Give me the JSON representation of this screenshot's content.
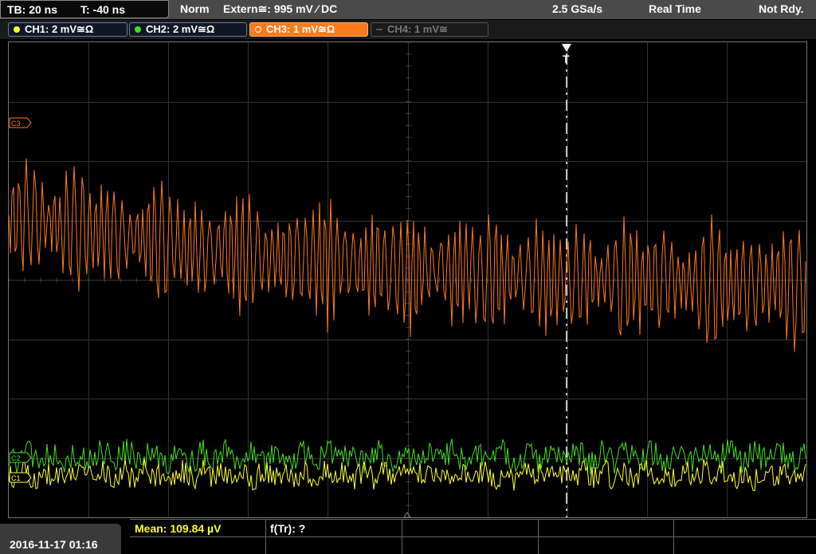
{
  "top": {
    "timebase": "TB: 20 ns",
    "trigger_time": "T: -40 ns",
    "trigger_mode": "Norm",
    "trigger_source": "Extern≅: 995 mV ⁄ DC",
    "sample_rate": "2.5 GSa/s",
    "acq_mode": "Real Time",
    "status": "Not Rdy."
  },
  "channels": [
    {
      "label": "CH1: 2 mV≅Ω",
      "color": "#ffff33",
      "state": "on"
    },
    {
      "label": "CH2: 2 mV≅Ω",
      "color": "#44dd22",
      "state": "on"
    },
    {
      "label": "CH3: 1 mV≅Ω",
      "color": "#ff7a1a",
      "state": "selected"
    },
    {
      "label": "CH4: 1 mV≅",
      "color": "#777777",
      "state": "off"
    }
  ],
  "markers": {
    "ch3": "C3",
    "ch2": "C2",
    "ch1": "C1",
    "trigger": "T"
  },
  "bottom": {
    "datetime": "2016-11-17 01:16",
    "mean": "Mean: 109.84 µV",
    "freq": "f(Tr): ?"
  },
  "colors": {
    "ch1": "#ffff33",
    "ch2": "#44dd22",
    "ch3": "#ff7a1a",
    "grid": "#3a3a3a",
    "mean_text": "#ffff33"
  }
}
